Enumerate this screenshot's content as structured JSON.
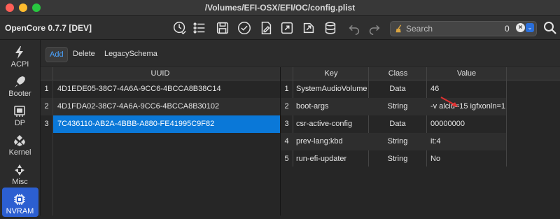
{
  "window": {
    "title": "/Volumes/EFI-OSX/EFI/OC/config.plist"
  },
  "toolbar": {
    "app_name": "OpenCore 0.7.7 [DEV]",
    "icons": [
      "clock-check-icon",
      "list-settings-icon",
      "save-icon",
      "check-circle-icon",
      "document-edit-icon",
      "share-icon",
      "database-icon",
      "undo-icon",
      "redo-icon"
    ],
    "search": {
      "placeholder": "Search",
      "count": "0",
      "clear": "×",
      "dropdown": "⌄"
    }
  },
  "sidebar": {
    "items": [
      {
        "label": "ACPI",
        "icon": "lightning-icon"
      },
      {
        "label": "Booter",
        "icon": "rocket-icon"
      },
      {
        "label": "DP",
        "icon": "device-card-icon"
      },
      {
        "label": "Kernel",
        "icon": "kernel-icon"
      },
      {
        "label": "Misc",
        "icon": "misc-icon"
      },
      {
        "label": "NVRAM",
        "icon": "chip-icon",
        "active": true
      }
    ]
  },
  "subbar": {
    "add": "Add",
    "delete": "Delete",
    "legacy": "LegacySchema"
  },
  "uuid_table": {
    "header": "UUID",
    "rows": [
      {
        "n": "1",
        "uuid": "4D1EDE05-38C7-4A6A-9CC6-4BCCA8B38C14"
      },
      {
        "n": "2",
        "uuid": "4D1FDA02-38C7-4A6A-9CC6-4BCCA8B30102"
      },
      {
        "n": "3",
        "uuid": "7C436110-AB2A-4BBB-A880-FE41995C9F82",
        "selected": true
      }
    ]
  },
  "kv_table": {
    "headers": {
      "key": "Key",
      "class": "Class",
      "value": "Value"
    },
    "rows": [
      {
        "n": "1",
        "key": "SystemAudioVolume",
        "class": "Data",
        "value": "46"
      },
      {
        "n": "2",
        "key": "boot-args",
        "class": "String",
        "value": "-v alcid=15 igfxonln=1"
      },
      {
        "n": "3",
        "key": "csr-active-config",
        "class": "Data",
        "value": "00000000"
      },
      {
        "n": "4",
        "key": "prev-lang:kbd",
        "class": "String",
        "value": "it:4"
      },
      {
        "n": "5",
        "key": "run-efi-updater",
        "class": "String",
        "value": "No"
      }
    ]
  },
  "colors": {
    "accent": "#0a78d8",
    "sidebar_active": "#2c5fd1",
    "annotation_arrow": "#e03030"
  }
}
